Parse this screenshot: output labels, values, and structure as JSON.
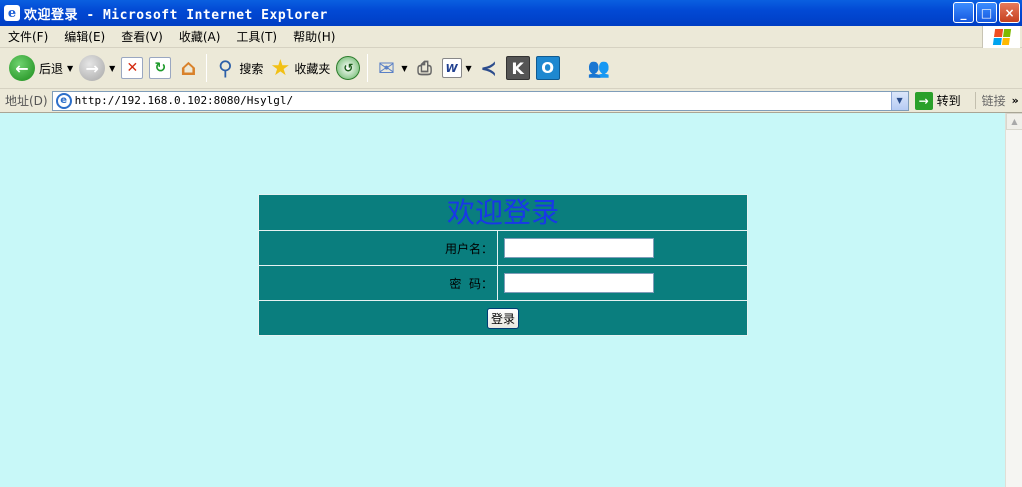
{
  "window": {
    "title": "欢迎登录 - Microsoft Internet Explorer",
    "minimize": "_",
    "maximize": "□",
    "close": "×"
  },
  "menu": [
    "文件(F)",
    "编辑(E)",
    "查看(V)",
    "收藏(A)",
    "工具(T)",
    "帮助(H)"
  ],
  "toolbar": {
    "back_label": "后退",
    "search_label": "搜索",
    "favorites_label": "收藏夹"
  },
  "address": {
    "label": "地址(D)",
    "url": "http://192.168.0.102:8080/Hsylgl/",
    "go_label": "转到",
    "links_label": "链接"
  },
  "login": {
    "title": "欢迎登录",
    "username_label": "用户名：",
    "username_value": "",
    "password_label": "密  码：",
    "password_value": "",
    "submit_label": "登录"
  },
  "colors": {
    "page_background": "#c8f8f8",
    "table_background": "#0a7e7e",
    "title_color": "#1838e8"
  }
}
